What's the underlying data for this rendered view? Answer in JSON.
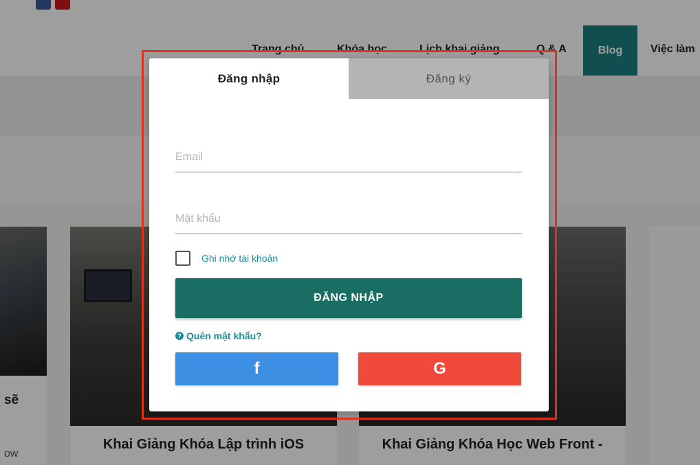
{
  "nav": {
    "items": [
      {
        "label": "Trang chủ"
      },
      {
        "label": "Khóa học"
      },
      {
        "label": "Lịch khai giảng"
      },
      {
        "label": "Q & A"
      }
    ],
    "blog_label": "Blog",
    "jobs_label": "Việc làm"
  },
  "cards": {
    "left_title_fragment": "sẽ",
    "left_sub_fragment": "ow",
    "a_title": "Khai Giảng Khóa Lập trình iOS",
    "b_title": "Khai Giảng Khóa Học Web Front -"
  },
  "modal": {
    "tabs": {
      "login": "Đăng nhập",
      "register": "Đăng ký"
    },
    "email_placeholder": "Email",
    "password_placeholder": "Mật khẩu",
    "remember_label": "Ghi nhớ tài khoản",
    "login_button": "ĐĂNG NHẬP",
    "forgot_label": "Quên mật khẩu?",
    "facebook_button": "f",
    "google_button": "G"
  },
  "colors": {
    "accent_teal": "#196d62",
    "link": "#1a8c9c",
    "facebook": "#3d8fe3",
    "google": "#ef4a3a",
    "highlight": "#e0331f",
    "blog_nav": "#1a7e82"
  },
  "icons": {
    "forgot": "question-circle-icon",
    "facebook": "facebook-icon",
    "google": "google-icon"
  }
}
